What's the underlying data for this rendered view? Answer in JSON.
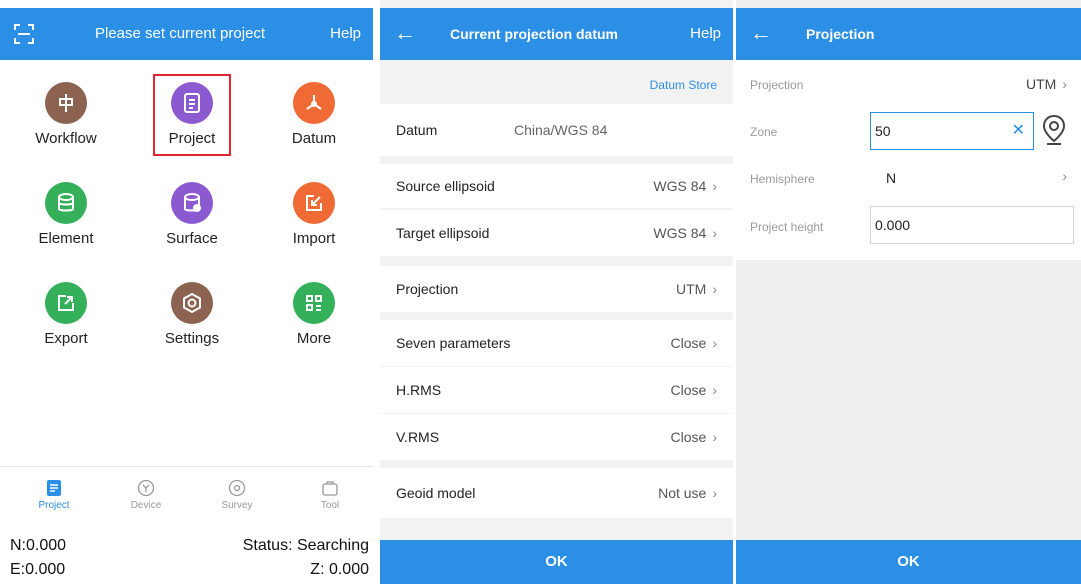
{
  "screen1": {
    "title": "Please set current project",
    "help": "Help",
    "tiles": [
      {
        "label": "Workflow",
        "color": "#8b6350"
      },
      {
        "label": "Project",
        "color": "#8c5ad0"
      },
      {
        "label": "Datum",
        "color": "#f06a36"
      },
      {
        "label": "Element",
        "color": "#34b05a"
      },
      {
        "label": "Surface",
        "color": "#8c5ad0"
      },
      {
        "label": "Import",
        "color": "#f06a36"
      },
      {
        "label": "Export",
        "color": "#34b05a"
      },
      {
        "label": "Settings",
        "color": "#8b6350"
      },
      {
        "label": "More",
        "color": "#34b05a"
      }
    ],
    "nav": [
      {
        "label": "Project"
      },
      {
        "label": "Device"
      },
      {
        "label": "Survey"
      },
      {
        "label": "Tool"
      }
    ],
    "status": {
      "n": "N:0.000",
      "e": "E:0.000",
      "status": "Status: Searching",
      "z": "Z: 0.000"
    }
  },
  "screen2": {
    "title": "Current projection datum",
    "help": "Help",
    "datum_store": "Datum Store",
    "datum_label": "Datum",
    "datum_value": "China/WGS 84",
    "rows": [
      {
        "label": "Source ellipsoid",
        "value": "WGS 84"
      },
      {
        "label": "Target ellipsoid",
        "value": "WGS 84"
      },
      {
        "label": "Projection",
        "value": "UTM"
      },
      {
        "label": "Seven parameters",
        "value": "Close"
      },
      {
        "label": "H.RMS",
        "value": "Close"
      },
      {
        "label": "V.RMS",
        "value": "Close"
      },
      {
        "label": "Geoid model",
        "value": "Not use"
      }
    ],
    "ok": "OK"
  },
  "screen3": {
    "title": "Projection",
    "projection_label": "Projection",
    "projection_value": "UTM",
    "zone_label": "Zone",
    "zone_value": "50",
    "hemisphere_label": "Hemisphere",
    "hemisphere_value": "N",
    "height_label": "Project height",
    "height_value": "0.000",
    "ok": "OK"
  },
  "colors": {
    "accent": "#2b8fe6",
    "highlight": "#e0262e"
  }
}
